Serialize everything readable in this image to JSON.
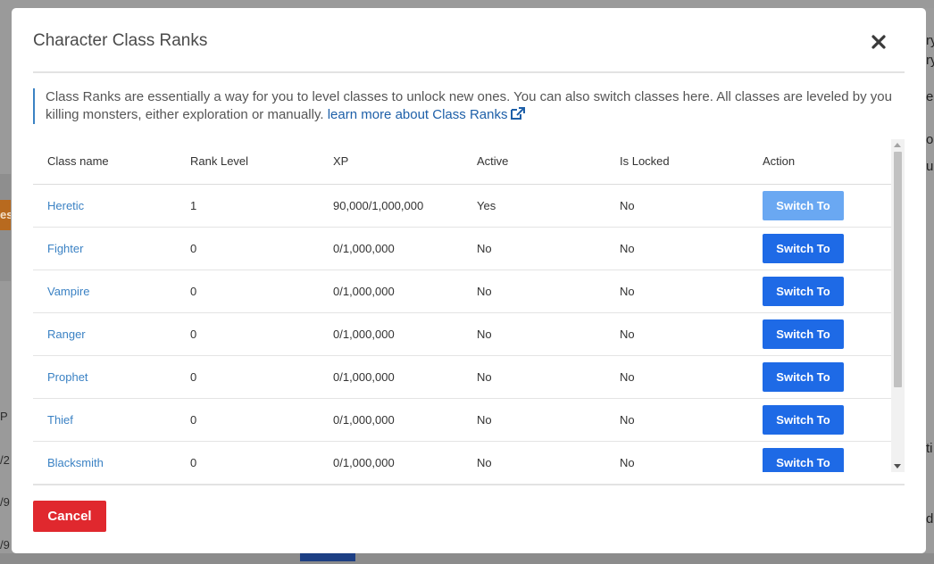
{
  "background": {
    "orange_text": "es",
    "left_fragments": [
      "P",
      "/2",
      "/9,",
      "/9,"
    ],
    "right_fragments": [
      "ry",
      "ry",
      "e",
      "o",
      "ur",
      "ti",
      "d"
    ]
  },
  "modal": {
    "title": "Character Class Ranks",
    "close_icon": "close-icon",
    "info_text": "Class Ranks are essentially a way for you to level classes to unlock new ones. You can also switch classes here. All classes are leveled by you killing monsters, either exploration or manually.",
    "info_link": "learn more about Class Ranks",
    "info_link_icon": "external-link-icon",
    "table": {
      "headers": [
        "Class name",
        "Rank Level",
        "XP",
        "Active",
        "Is Locked",
        "Action"
      ],
      "rows": [
        {
          "name": "Heretic",
          "rank": "1",
          "xp": "90,000/1,000,000",
          "active": "Yes",
          "locked": "No",
          "action": "Switch To",
          "enabled": false
        },
        {
          "name": "Fighter",
          "rank": "0",
          "xp": "0/1,000,000",
          "active": "No",
          "locked": "No",
          "action": "Switch To",
          "enabled": true
        },
        {
          "name": "Vampire",
          "rank": "0",
          "xp": "0/1,000,000",
          "active": "No",
          "locked": "No",
          "action": "Switch To",
          "enabled": true
        },
        {
          "name": "Ranger",
          "rank": "0",
          "xp": "0/1,000,000",
          "active": "No",
          "locked": "No",
          "action": "Switch To",
          "enabled": true
        },
        {
          "name": "Prophet",
          "rank": "0",
          "xp": "0/1,000,000",
          "active": "No",
          "locked": "No",
          "action": "Switch To",
          "enabled": true
        },
        {
          "name": "Thief",
          "rank": "0",
          "xp": "0/1,000,000",
          "active": "No",
          "locked": "No",
          "action": "Switch To",
          "enabled": true
        },
        {
          "name": "Blacksmith",
          "rank": "0",
          "xp": "0/1,000,000",
          "active": "No",
          "locked": "No",
          "action": "Switch To",
          "enabled": true
        }
      ]
    },
    "cancel_label": "Cancel"
  },
  "colors": {
    "primary": "#1e6ae6",
    "primary_disabled": "#6aa8f2",
    "danger": "#e0282e",
    "link": "#3b82c4"
  }
}
